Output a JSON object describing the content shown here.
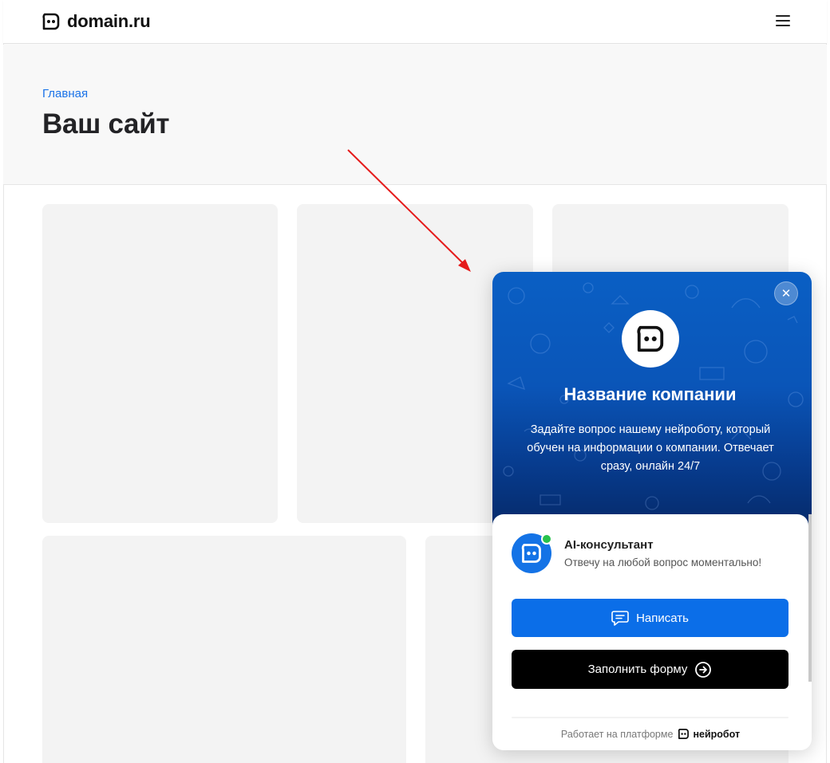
{
  "header": {
    "logo_text": "domain.ru",
    "logo_icon": "robot-face-icon",
    "menu_icon": "hamburger-menu-icon"
  },
  "hero": {
    "breadcrumb": "Главная",
    "title": "Ваш сайт"
  },
  "widget": {
    "close_icon": "close-icon",
    "company_name": "Название компании",
    "description": "Задайте вопрос нашему нейроботу, который обучен на информации о компании. Отвечает сразу, онлайн 24/7",
    "agent": {
      "name": "AI-консультант",
      "status": "Отвечу на любой вопрос моментально!",
      "online": true
    },
    "write_button": {
      "label": "Написать",
      "icon": "chat-bubble-icon"
    },
    "form_button": {
      "label": "Заполнить форму",
      "icon": "arrow-circle-right-icon"
    },
    "powered_by": "Работает на платформе",
    "brand": "нейробот"
  },
  "colors": {
    "accent": "#0b6ee8",
    "breadcrumb": "#1a73e8",
    "online": "#27c24c",
    "annotation_arrow": "#e51b1b"
  }
}
